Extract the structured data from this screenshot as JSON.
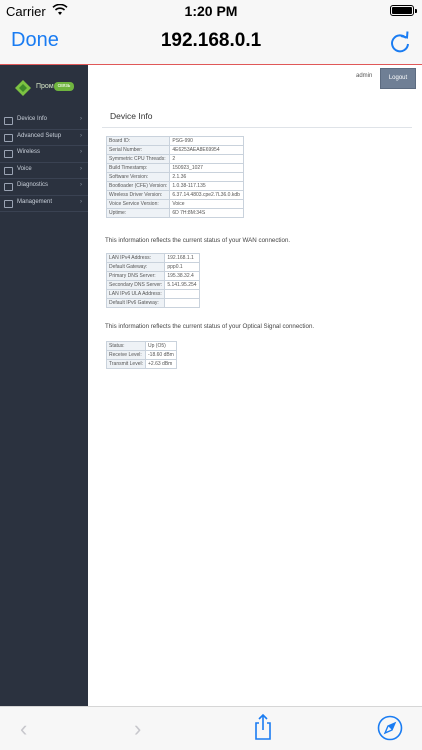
{
  "status_bar": {
    "carrier": "Carrier",
    "time": "1:20 PM"
  },
  "navbar": {
    "done_label": "Done",
    "title": "192.168.0.1"
  },
  "router": {
    "logo_text": "Пром",
    "logo_badge": "связь",
    "user": "admin",
    "logout_label": "Logout",
    "menu": [
      {
        "label": "Device Info"
      },
      {
        "label": "Advanced Setup"
      },
      {
        "label": "Wireless"
      },
      {
        "label": "Voice"
      },
      {
        "label": "Diagnostics"
      },
      {
        "label": "Management"
      }
    ],
    "page_title": "Device Info",
    "device_rows": [
      {
        "key": "Board ID:",
        "value": "PSG-990"
      },
      {
        "key": "Serial Number:",
        "value": "4E6253AEA8E69954"
      },
      {
        "key": "Symmetric CPU Threads:",
        "value": "2"
      },
      {
        "key": "Build Timestamp:",
        "value": "150923_1027"
      },
      {
        "key": "Software Version:",
        "value": "2.1.36"
      },
      {
        "key": "Bootloader (CFE) Version:",
        "value": "1.0.38-117.135"
      },
      {
        "key": "Wireless Driver Version:",
        "value": "6.37.14.4803.cpe2.7L36.0.kdb"
      },
      {
        "key": "Voice Service Version:",
        "value": "Voice"
      },
      {
        "key": "Uptime:",
        "value": "6D 7H:8M:34S"
      }
    ],
    "wan_note": "This information reflects the current status of your WAN connection.",
    "wan_rows": [
      {
        "key": "LAN IPv4 Address:",
        "value": "192.168.1.1"
      },
      {
        "key": "Default Gateway:",
        "value": "ppp0.1"
      },
      {
        "key": "Primary DNS Server:",
        "value": "195.38.32.4"
      },
      {
        "key": "Secondary DNS Server:",
        "value": "5.141.95.254"
      },
      {
        "key": "LAN IPv6 ULA Address:",
        "value": ""
      },
      {
        "key": "Default IPv6 Gateway:",
        "value": ""
      }
    ],
    "optical_note": "This information reflects the current status of your Optical Signal connection.",
    "optical_rows": [
      {
        "key": "Status:",
        "value": "Up (O5)"
      },
      {
        "key": "Receive Level:",
        "value": "-18.60 dBm"
      },
      {
        "key": "Transmit Level:",
        "value": "+2.63 dBm"
      }
    ]
  },
  "colors": {
    "accent": "#1a7cf2",
    "sidebar": "#2b323f",
    "logo_green": "#6fb43f"
  },
  "icons": [
    "wifi-icon",
    "battery-icon",
    "reload-icon",
    "back-icon",
    "forward-icon",
    "share-icon",
    "compass-icon"
  ]
}
